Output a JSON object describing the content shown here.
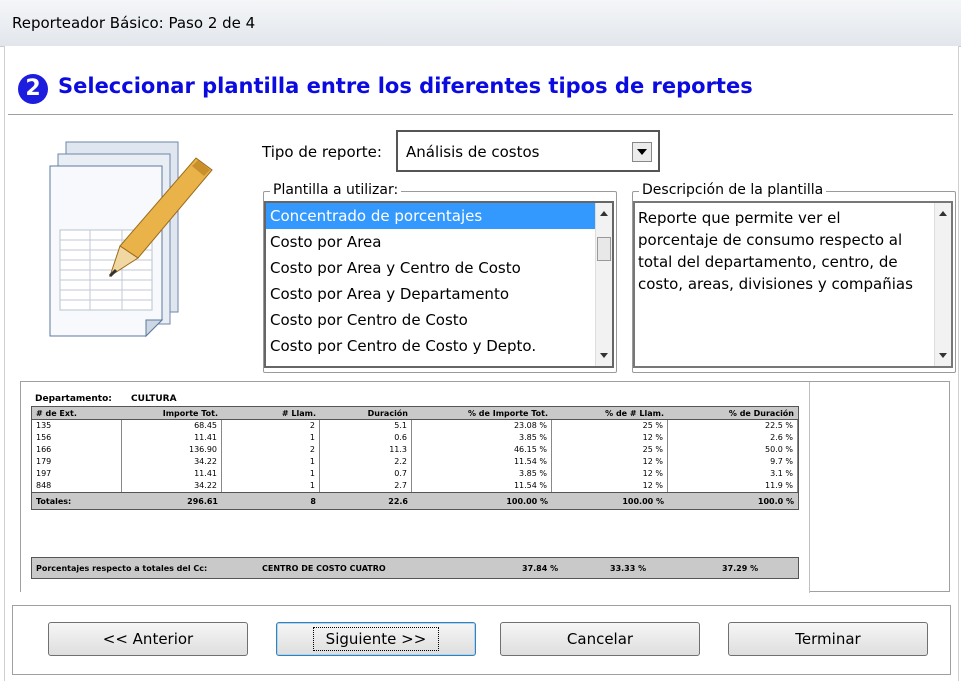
{
  "window": {
    "title": "Reporteador Básico: Paso 2 de 4"
  },
  "header": {
    "step_number": "2",
    "title": "Seleccionar plantilla entre los diferentes tipos de reportes"
  },
  "report_type": {
    "label": "Tipo de reporte:",
    "value": "Análisis de costos"
  },
  "templates": {
    "group_label": "Plantilla a utilizar:",
    "items": [
      {
        "label": "Concentrado de porcentajes",
        "selected": true
      },
      {
        "label": "Costo por Area"
      },
      {
        "label": "Costo por Area y Centro de Costo"
      },
      {
        "label": "Costo por Area y Departamento"
      },
      {
        "label": "Costo por Centro de Costo"
      },
      {
        "label": "Costo por Centro de Costo y Depto."
      }
    ]
  },
  "description": {
    "group_label": "Descripción de la plantilla",
    "text": "Reporte que permite ver el porcentaje de consumo respecto al total del departamento, centro, de costo, areas, divisiones y compañias"
  },
  "preview": {
    "department_label": "Departamento:",
    "department_value": "CULTURA",
    "headers": [
      "# de Ext.",
      "Importe Tot.",
      "# Llam.",
      "Duración",
      "% de Importe Tot.",
      "% de # Llam.",
      "% de Duración"
    ],
    "rows": [
      [
        "135",
        "68.45",
        "2",
        "5.1",
        "23.08 %",
        "25 %",
        "22.5 %"
      ],
      [
        "156",
        "11.41",
        "1",
        "0.6",
        "3.85 %",
        "12 %",
        "2.6 %"
      ],
      [
        "166",
        "136.90",
        "2",
        "11.3",
        "46.15 %",
        "25 %",
        "50.0 %"
      ],
      [
        "179",
        "34.22",
        "1",
        "2.2",
        "11.54 %",
        "12 %",
        "9.7 %"
      ],
      [
        "197",
        "11.41",
        "1",
        "0.7",
        "3.85 %",
        "12 %",
        "3.1 %"
      ],
      [
        "848",
        "34.22",
        "1",
        "2.7",
        "11.54 %",
        "12 %",
        "11.9 %"
      ]
    ],
    "totals": [
      "Totales:",
      "296.61",
      "8",
      "22.6",
      "100.00 %",
      "100.00 %",
      "100.0 %"
    ],
    "percent_label": "Porcentajes respecto a totales del Cc:",
    "percent_cc": "CENTRO DE COSTO CUATRO",
    "percent_values": [
      "37.84 %",
      "33.33 %",
      "37.29 %"
    ]
  },
  "buttons": {
    "back": "<< Anterior",
    "next": "Siguiente >>",
    "cancel": "Cancelar",
    "finish": "Terminar"
  },
  "colors": {
    "accent": "#0b0be0",
    "selection": "#3399ff"
  }
}
